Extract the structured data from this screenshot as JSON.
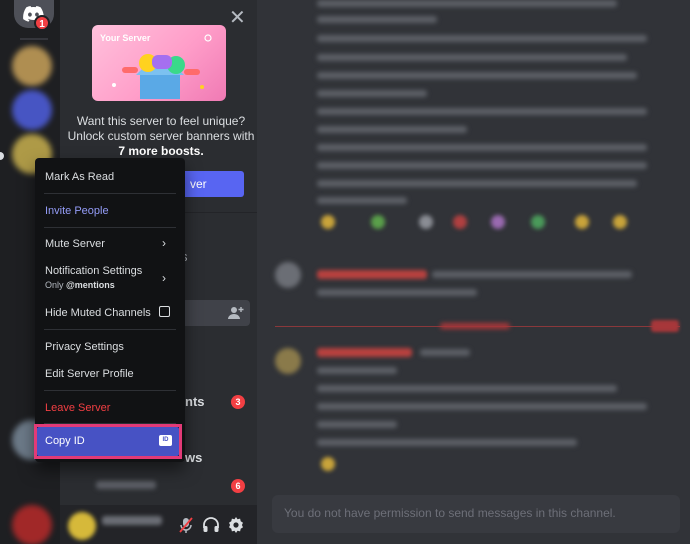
{
  "app": {
    "home_badge": "1"
  },
  "promo": {
    "banner_title": "Your Server",
    "line1": "Want this server to feel unique?",
    "line2": "Unlock custom server banners with",
    "boosts": "7 more boosts.",
    "button_partial": "ver"
  },
  "sidebar": {
    "partial_s": "s",
    "partial_nts": "nts",
    "partial_ws": "ws",
    "badge_a": "3",
    "badge_b": "6"
  },
  "menu": {
    "mark_read": "Mark As Read",
    "invite": "Invite People",
    "mute": "Mute Server",
    "notif": "Notification Settings",
    "notif_sub_prefix": "Only ",
    "notif_sub_bold": "@mentions",
    "hide_muted": "Hide Muted Channels",
    "privacy": "Privacy Settings",
    "edit_profile": "Edit Server Profile",
    "leave": "Leave Server",
    "copy_id": "Copy ID",
    "id_icon_text": "ID"
  },
  "chat": {
    "input_placeholder": "You do not have permission to send messages in this channel."
  },
  "colors": {
    "accent": "#5865f2",
    "danger": "#f23f43",
    "highlight_outline": "#e23a77",
    "invite": "#949cf7"
  },
  "icons": [
    "discord-logo-icon",
    "close-icon",
    "chevron-right-icon",
    "checkbox-icon",
    "id-icon",
    "add-member-icon",
    "mute-mic-icon",
    "headphones-icon",
    "gear-icon"
  ]
}
